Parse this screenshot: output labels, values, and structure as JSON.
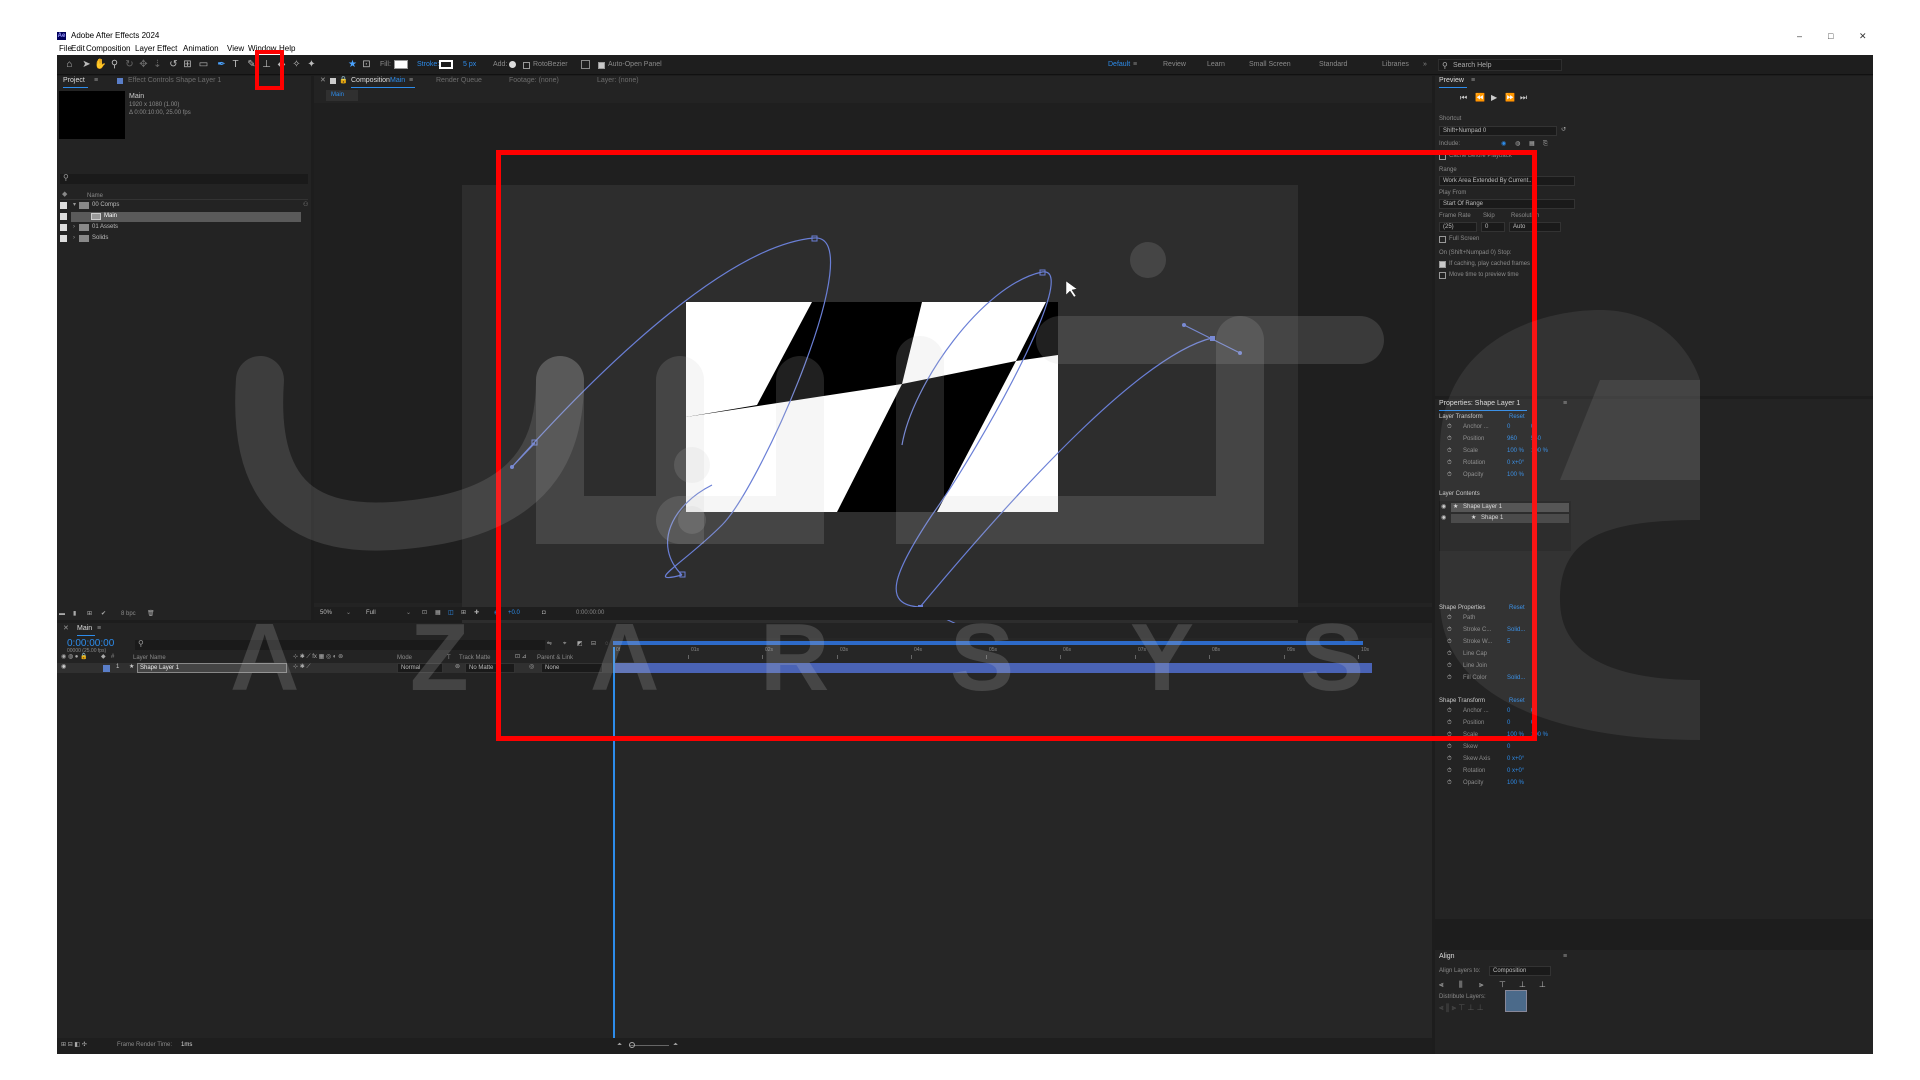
{
  "window": {
    "app_title": "Adobe After Effects 2024",
    "logo": "Ae",
    "minimize": "–",
    "maximize": "□",
    "close": "✕"
  },
  "menu": [
    "File",
    "Edit",
    "Composition",
    "Layer",
    "Effect",
    "Animation",
    "View",
    "Window",
    "Help"
  ],
  "toolbar": {
    "fill_label": "Fill:",
    "stroke_label": "Stroke:",
    "stroke_width": "5 px",
    "add_label": "Add:",
    "rotobezier": "RotoBezier",
    "auto_open": "Auto-Open Panel",
    "workspaces": [
      "Default",
      "Review",
      "Learn",
      "Small Screen",
      "Standard",
      "Libraries"
    ],
    "search_help": "Search Help"
  },
  "project": {
    "tab_project": "Project",
    "tab_effects": "Effect Controls Shape Layer 1",
    "comp_name": "Main",
    "comp_res": "1920 x 1080 (1.00)",
    "comp_dur": "Δ 0:00:10:00, 25.00 fps",
    "search_placeholder": "",
    "col_name": "Name",
    "items": [
      {
        "label": "00 Comps",
        "type": "folder"
      },
      {
        "label": "Main",
        "type": "comp"
      },
      {
        "label": "01 Assets",
        "type": "folder"
      },
      {
        "label": "Solids",
        "type": "folder"
      }
    ],
    "bpc": "8 bpc"
  },
  "composition": {
    "tab_comp": "Composition",
    "tab_comp_name": "Main",
    "tab_render": "Render Queue",
    "tab_footage": "Footage: (none)",
    "tab_layer": "Layer: (none)",
    "breadcrumb": "Main",
    "zoom": "50%",
    "resolution": "Full",
    "exposure": "+0.0",
    "timecode": "0:00:00:00"
  },
  "timeline": {
    "tab": "Main",
    "timecode": "0:00:00:00",
    "timecode_sub": "00000 (25.00 fps)",
    "col_layer_name": "Layer Name",
    "col_mode": "Mode",
    "col_t": "T",
    "col_track_matte": "Track Matte",
    "col_parent": "Parent & Link",
    "layer_num": "1",
    "layer_name": "Shape Layer 1",
    "layer_mode": "Normal",
    "layer_matte": "No Matte",
    "layer_parent": "None",
    "ruler": [
      "0f",
      "01s",
      "02s",
      "03s",
      "04s",
      "05s",
      "06s",
      "07s",
      "08s",
      "09s",
      "10s"
    ],
    "frame_render_label": "Frame Render Time:",
    "frame_render_value": "1ms"
  },
  "preview": {
    "title": "Preview",
    "shortcut_label": "Shortcut",
    "shortcut_value": "Shift+Numpad 0",
    "include_label": "Include:",
    "cache_before": "Cache Before Playback",
    "range_label": "Range",
    "range_value": "Work Area Extended By Current...",
    "play_from_label": "Play From",
    "play_from_value": "Start Of Range",
    "frame_rate_label": "Frame Rate",
    "skip_label": "Skip",
    "resolution_label": "Resolution",
    "frame_rate_value": "(25)",
    "skip_value": "0",
    "resolution_value": "Auto",
    "full_screen": "Full Screen",
    "on_stop_label": "On (Shift+Numpad 0) Stop:",
    "if_caching": "If caching, play cached frames",
    "move_time": "Move time to preview time"
  },
  "properties": {
    "title": "Properties: Shape Layer 1",
    "layer_transform": "Layer Transform",
    "reset": "Reset",
    "rows": [
      {
        "label": "Anchor ...",
        "v1": "0",
        "v2": "0"
      },
      {
        "label": "Position",
        "v1": "960",
        "v2": "540"
      },
      {
        "label": "Scale",
        "v1": "100 %",
        "v2": "100 %"
      },
      {
        "label": "Rotation",
        "v1": "0 x+0°",
        "v2": ""
      },
      {
        "label": "Opacity",
        "v1": "100 %",
        "v2": ""
      }
    ],
    "layer_contents": "Layer Contents",
    "contents": [
      "Shape Layer 1",
      "Shape 1"
    ],
    "shape_properties": "Shape Properties",
    "shape_rows": [
      {
        "label": "Path",
        "v1": ""
      },
      {
        "label": "Stroke C...",
        "v1": "Solid..."
      },
      {
        "label": "Stroke W...",
        "v1": "5"
      },
      {
        "label": "Line Cap",
        "v1": ""
      },
      {
        "label": "Line Join",
        "v1": ""
      },
      {
        "label": "Fill Color",
        "v1": "Solid..."
      }
    ],
    "shape_transform": "Shape Transform",
    "st_rows": [
      {
        "label": "Anchor ...",
        "v1": "0",
        "v2": "0"
      },
      {
        "label": "Position",
        "v1": "0",
        "v2": "0"
      },
      {
        "label": "Scale",
        "v1": "100 %",
        "v2": "100 %"
      },
      {
        "label": "Skew",
        "v1": "0",
        "v2": ""
      },
      {
        "label": "Skew Axis",
        "v1": "0 x+0°",
        "v2": ""
      },
      {
        "label": "Rotation",
        "v1": "0 x+0°",
        "v2": ""
      },
      {
        "label": "Opacity",
        "v1": "100 %",
        "v2": ""
      }
    ]
  },
  "align": {
    "title": "Align",
    "align_to_label": "Align Layers to:",
    "align_to_value": "Composition",
    "distribute": "Distribute Layers:"
  },
  "watermark": {
    "brand": "AZARSYS",
    "letters": [
      "A",
      "Z",
      "A",
      "R",
      "S",
      "Y",
      "S"
    ]
  },
  "colors": {
    "accent": "#2d8ceb",
    "highlight_red": "#ff0000",
    "panel_bg": "#232323",
    "comp_bg": "#2b2b2b"
  }
}
